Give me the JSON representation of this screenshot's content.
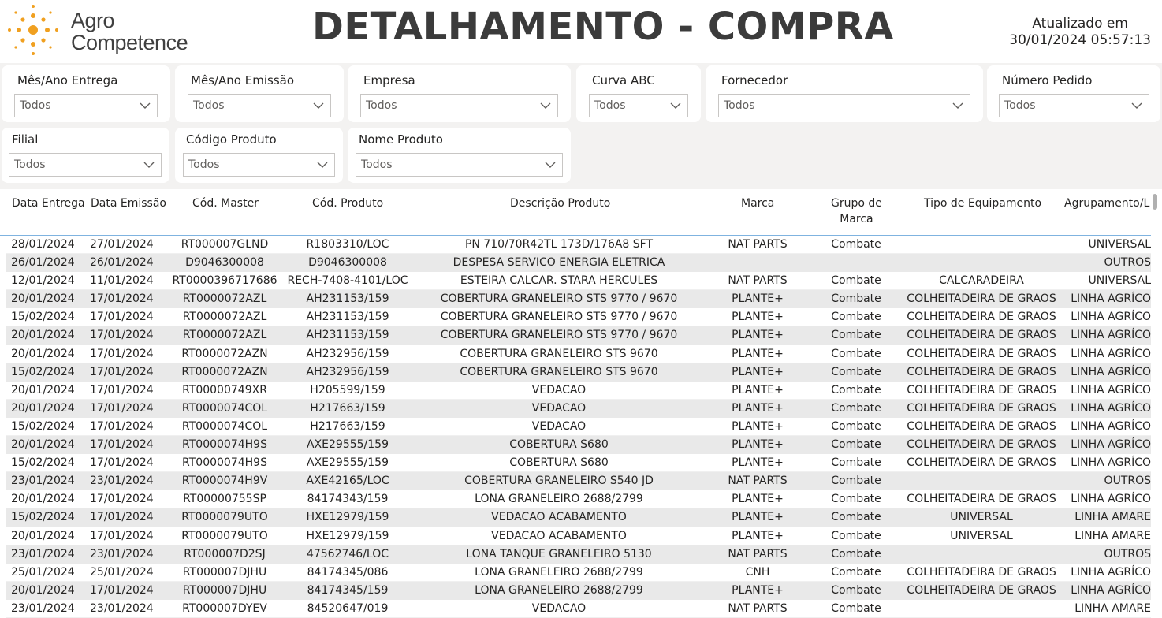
{
  "header": {
    "logo_line1": "Agro",
    "logo_line2": "Competence",
    "title": "DETALHAMENTO - COMPRA",
    "updated_label": "Atualizado em",
    "updated_value": "30/01/2024 05:57:13"
  },
  "filters": [
    {
      "label": "Mês/Ano Entrega",
      "value": "Todos"
    },
    {
      "label": "Mês/Ano Emissão",
      "value": "Todos"
    },
    {
      "label": "Empresa",
      "value": "Todos"
    },
    {
      "label": "Curva ABC",
      "value": "Todos"
    },
    {
      "label": "Fornecedor",
      "value": "Todos"
    },
    {
      "label": "Número Pedido",
      "value": "Todos"
    },
    {
      "label": "Filial",
      "value": "Todos"
    },
    {
      "label": "Código Produto",
      "value": "Todos"
    },
    {
      "label": "Nome Produto",
      "value": "Todos"
    }
  ],
  "table": {
    "columns": [
      "Data Entrega",
      "Data Emissão",
      "Cód. Master",
      "Cód. Produto",
      "Descrição Produto",
      "Marca",
      "Grupo de\nMarca",
      "Tipo de Equipamento",
      "Agrupamento/L"
    ],
    "rows": [
      [
        "28/01/2024",
        "27/01/2024",
        "RT000007GLND",
        "R1803310/LOC",
        "PN 710/70R42TL 173D/176A8 SFT",
        "NAT PARTS",
        "Combate",
        "",
        "UNIVERSAL"
      ],
      [
        "26/01/2024",
        "26/01/2024",
        "D9046300008",
        "D9046300008",
        "DESPESA SERVICO ENERGIA ELETRICA",
        "",
        "",
        "",
        "OUTROS"
      ],
      [
        "12/01/2024",
        "11/01/2024",
        "RT0000396717686",
        "RECH-7408-4101/LOC",
        "ESTEIRA CALCAR. STARA HERCULES",
        "NAT PARTS",
        "Combate",
        "CALCARADEIRA",
        "UNIVERSAL"
      ],
      [
        "20/01/2024",
        "17/01/2024",
        "RT0000072AZL",
        "AH231153/159",
        "COBERTURA GRANELEIRO STS 9770 / 9670",
        "PLANTE+",
        "Combate",
        "COLHEITADEIRA DE GRAOS",
        "LINHA AGRÍCO"
      ],
      [
        "15/02/2024",
        "17/01/2024",
        "RT0000072AZL",
        "AH231153/159",
        "COBERTURA GRANELEIRO STS 9770 / 9670",
        "PLANTE+",
        "Combate",
        "COLHEITADEIRA DE GRAOS",
        "LINHA AGRÍCO"
      ],
      [
        "20/01/2024",
        "17/01/2024",
        "RT0000072AZL",
        "AH231153/159",
        "COBERTURA GRANELEIRO STS 9770 / 9670",
        "PLANTE+",
        "Combate",
        "COLHEITADEIRA DE GRAOS",
        "LINHA AGRÍCO"
      ],
      [
        "20/01/2024",
        "17/01/2024",
        "RT0000072AZN",
        "AH232956/159",
        "COBERTURA GRANELEIRO STS 9670",
        "PLANTE+",
        "Combate",
        "COLHEITADEIRA DE GRAOS",
        "LINHA AGRÍCO"
      ],
      [
        "15/02/2024",
        "17/01/2024",
        "RT0000072AZN",
        "AH232956/159",
        "COBERTURA GRANELEIRO STS 9670",
        "PLANTE+",
        "Combate",
        "COLHEITADEIRA DE GRAOS",
        "LINHA AGRÍCO"
      ],
      [
        "20/01/2024",
        "17/01/2024",
        "RT00000749XR",
        "H205599/159",
        "VEDACAO",
        "PLANTE+",
        "Combate",
        "COLHEITADEIRA DE GRAOS",
        "LINHA AGRÍCO"
      ],
      [
        "20/01/2024",
        "17/01/2024",
        "RT0000074COL",
        "H217663/159",
        "VEDACAO",
        "PLANTE+",
        "Combate",
        "COLHEITADEIRA DE GRAOS",
        "LINHA AGRÍCO"
      ],
      [
        "15/02/2024",
        "17/01/2024",
        "RT0000074COL",
        "H217663/159",
        "VEDACAO",
        "PLANTE+",
        "Combate",
        "COLHEITADEIRA DE GRAOS",
        "LINHA AGRÍCO"
      ],
      [
        "20/01/2024",
        "17/01/2024",
        "RT0000074H9S",
        "AXE29555/159",
        "COBERTURA S680",
        "PLANTE+",
        "Combate",
        "COLHEITADEIRA DE GRAOS",
        "LINHA AGRÍCO"
      ],
      [
        "15/02/2024",
        "17/01/2024",
        "RT0000074H9S",
        "AXE29555/159",
        "COBERTURA S680",
        "PLANTE+",
        "Combate",
        "COLHEITADEIRA DE GRAOS",
        "LINHA AGRÍCO"
      ],
      [
        "23/01/2024",
        "23/01/2024",
        "RT0000074H9V",
        "AXE42165/LOC",
        "COBERTURA GRANELEIRO S540 JD",
        "NAT PARTS",
        "Combate",
        "",
        "OUTROS"
      ],
      [
        "20/01/2024",
        "17/01/2024",
        "RT00000755SP",
        "84174343/159",
        "LONA GRANELEIRO 2688/2799",
        "PLANTE+",
        "Combate",
        "COLHEITADEIRA DE GRAOS",
        "LINHA AGRÍCO"
      ],
      [
        "15/02/2024",
        "17/01/2024",
        "RT0000079UTO",
        "HXE12979/159",
        "VEDACAO ACABAMENTO",
        "PLANTE+",
        "Combate",
        "UNIVERSAL",
        "LINHA AMARE"
      ],
      [
        "20/01/2024",
        "17/01/2024",
        "RT0000079UTO",
        "HXE12979/159",
        "VEDACAO ACABAMENTO",
        "PLANTE+",
        "Combate",
        "UNIVERSAL",
        "LINHA AMARE"
      ],
      [
        "23/01/2024",
        "23/01/2024",
        "RT000007D2SJ",
        "47562746/LOC",
        "LONA TANQUE GRANELEIRO 5130",
        "NAT PARTS",
        "Combate",
        "",
        "OUTROS"
      ],
      [
        "25/01/2024",
        "25/01/2024",
        "RT000007DJHU",
        "84174345/086",
        "LONA GRANELEIRO 2688/2799",
        "CNH",
        "Combate",
        "COLHEITADEIRA DE GRAOS",
        "LINHA AGRÍCO"
      ],
      [
        "20/01/2024",
        "17/01/2024",
        "RT000007DJHU",
        "84174345/159",
        "LONA GRANELEIRO 2688/2799",
        "PLANTE+",
        "Combate",
        "COLHEITADEIRA DE GRAOS",
        "LINHA AGRÍCO"
      ],
      [
        "23/01/2024",
        "23/01/2024",
        "RT000007DYEV",
        "84520647/019",
        "VEDACAO",
        "NAT PARTS",
        "Combate",
        "",
        "LINHA AMARE"
      ]
    ]
  },
  "colors": {
    "logo_orange": "#f0a020",
    "header_underline": "#7fb3e0",
    "row_alt": "#e9e9e9"
  }
}
